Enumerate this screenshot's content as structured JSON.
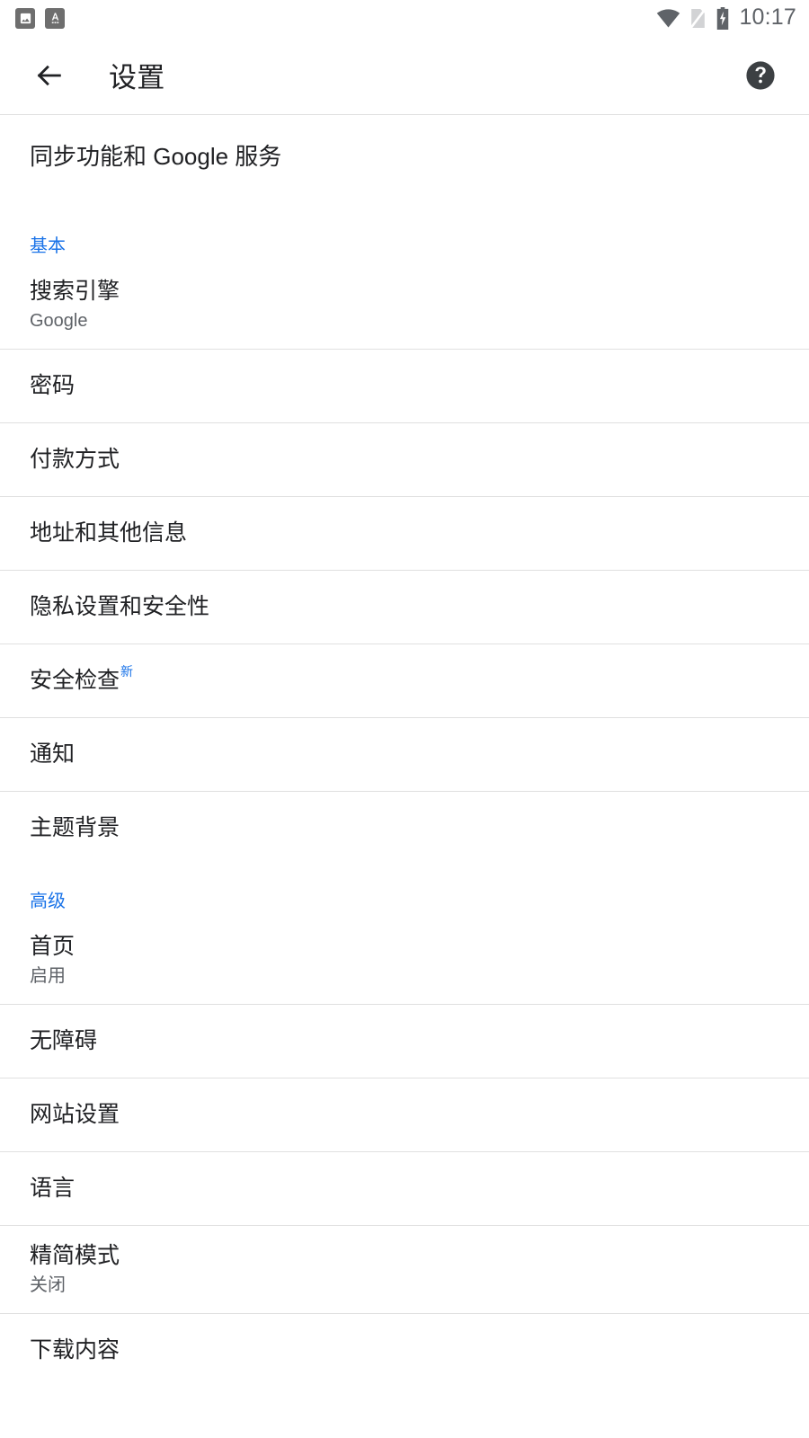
{
  "status_bar": {
    "notifications": [
      {
        "icon": "image-notification-icon",
        "name": "image"
      },
      {
        "icon": "text-app-notification-icon",
        "name": "A"
      }
    ],
    "system": [
      {
        "icon": "wifi-icon"
      },
      {
        "icon": "no-sim-signal-icon"
      },
      {
        "icon": "battery-charging-icon"
      }
    ],
    "time": "10:17"
  },
  "toolbar": {
    "back_icon": "back-arrow-icon",
    "title": "设置",
    "help_icon": "help-circle-icon"
  },
  "content": {
    "account_row": {
      "title": "同步功能和 Google 服务"
    },
    "sections": [
      {
        "id": "basic",
        "label": "基本",
        "items": [
          {
            "id": "search-engine",
            "title": "搜索引擎",
            "subtitle": "Google",
            "badge": null
          },
          {
            "id": "passwords",
            "title": "密码",
            "subtitle": null,
            "badge": null
          },
          {
            "id": "payment-methods",
            "title": "付款方式",
            "subtitle": null,
            "badge": null
          },
          {
            "id": "addresses",
            "title": "地址和其他信息",
            "subtitle": null,
            "badge": null
          },
          {
            "id": "privacy-security",
            "title": "隐私设置和安全性",
            "subtitle": null,
            "badge": null
          },
          {
            "id": "safety-check",
            "title": "安全检查",
            "subtitle": null,
            "badge": "新"
          },
          {
            "id": "notifications",
            "title": "通知",
            "subtitle": null,
            "badge": null
          },
          {
            "id": "theme",
            "title": "主题背景",
            "subtitle": null,
            "badge": null
          }
        ]
      },
      {
        "id": "advanced",
        "label": "高级",
        "items": [
          {
            "id": "homepage",
            "title": "首页",
            "subtitle": "启用",
            "badge": null
          },
          {
            "id": "accessibility",
            "title": "无障碍",
            "subtitle": null,
            "badge": null
          },
          {
            "id": "site-settings",
            "title": "网站设置",
            "subtitle": null,
            "badge": null
          },
          {
            "id": "languages",
            "title": "语言",
            "subtitle": null,
            "badge": null
          },
          {
            "id": "lite-mode",
            "title": "精简模式",
            "subtitle": "关闭",
            "badge": null
          },
          {
            "id": "downloads",
            "title": "下载内容",
            "subtitle": null,
            "badge": null
          }
        ]
      }
    ]
  },
  "colors": {
    "accent_blue": "#1a73e8",
    "text_primary": "#202124",
    "text_secondary": "#5f6368",
    "divider": "#e0e0e0",
    "background": "#ffffff"
  }
}
